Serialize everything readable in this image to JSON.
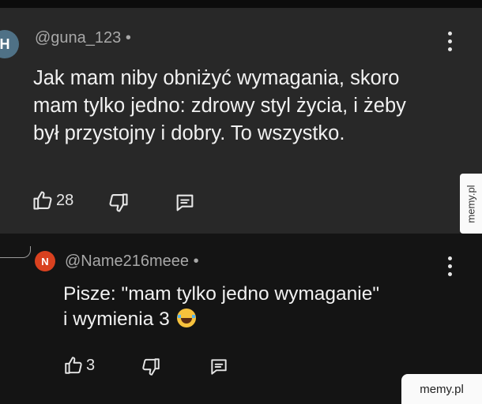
{
  "comments": [
    {
      "avatar_letter": "H",
      "username": "@guna_123 •",
      "text_lines": [
        "Jak mam niby obniżyć wymagania, skoro",
        "mam tylko jedno: zdrowy styl życia, i żeby",
        "był przystojny i dobry. To wszystko."
      ],
      "likes": "28"
    },
    {
      "avatar_letter": "N",
      "username": "@Name216meee •",
      "text_lines": [
        "Pisze: \"mam tylko jedno wymaganie\"",
        "i wymienia 3"
      ],
      "emoji": "face-with-tears-of-joy-emoji",
      "likes": "3"
    }
  ],
  "watermark": {
    "side": "memy.pl",
    "corner": "memy.pl"
  },
  "colors": {
    "comment_bg": "#282828",
    "reply_bg": "#141414",
    "text": "#f1f1f1",
    "username": "#a8a8a8",
    "avatar_h": "#4f7186",
    "avatar_n": "#d9411f"
  }
}
